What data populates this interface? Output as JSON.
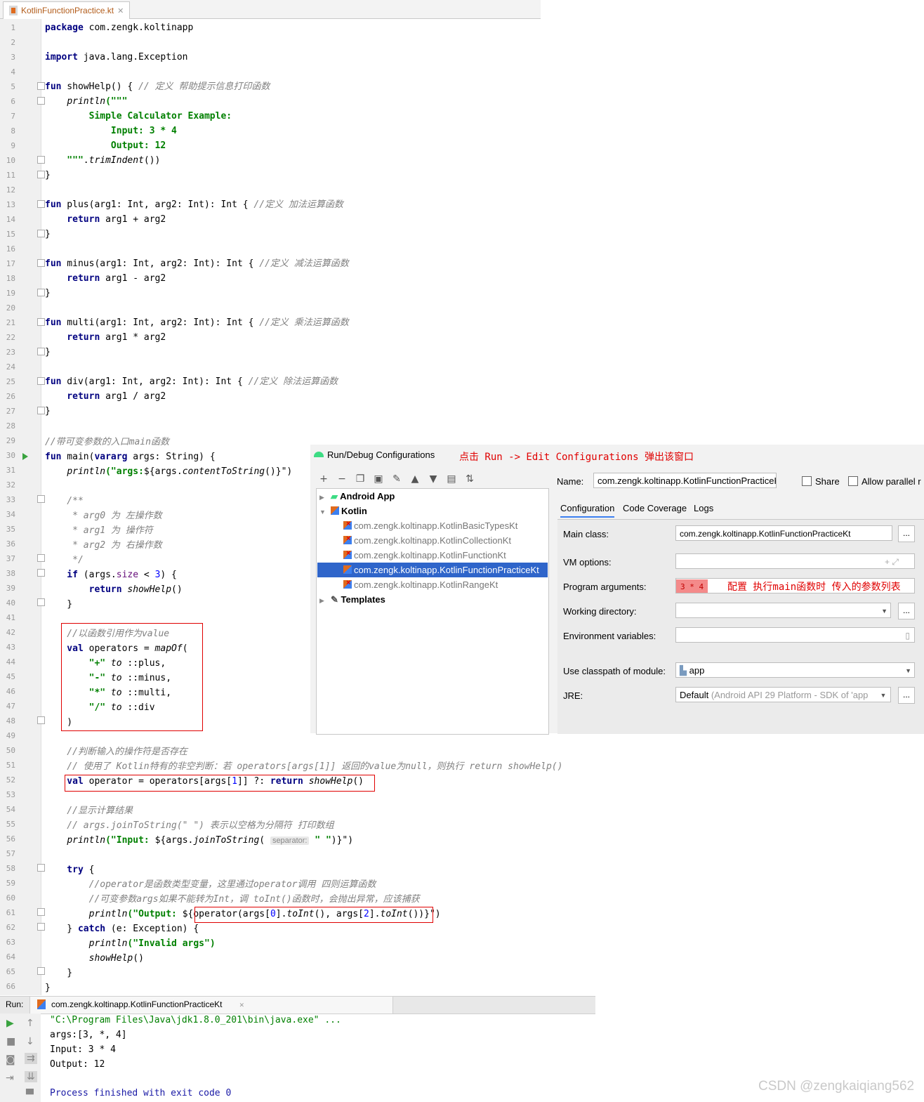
{
  "tab": {
    "title": "KotlinFunctionPractice.kt"
  },
  "editor": {
    "line_numbers": [
      "1",
      "2",
      "3",
      "4",
      "5",
      "6",
      "7",
      "8",
      "9",
      "10",
      "11",
      "12",
      "13",
      "14",
      "15",
      "16",
      "17",
      "18",
      "19",
      "20",
      "21",
      "22",
      "23",
      "24",
      "25",
      "26",
      "27",
      "28",
      "29",
      "30",
      "31",
      "32",
      "33",
      "34",
      "35",
      "36",
      "37",
      "38",
      "39",
      "40",
      "41",
      "42",
      "43",
      "44",
      "45",
      "46",
      "47",
      "48",
      "49",
      "50",
      "51",
      "52",
      "53",
      "54",
      "55",
      "56",
      "57",
      "58",
      "59",
      "60",
      "61",
      "62",
      "63",
      "64",
      "65",
      "66"
    ],
    "l1a": "package",
    "l1b": " com.zengk.koltinapp",
    "l3a": "import",
    "l3b": " java.lang.Exception",
    "l5a": "fun",
    "l5b": " showHelp() { ",
    "l5c": "// 定义 帮助提示信息打印函数",
    "l6a": "    ",
    "l6b": "println",
    "l6c": "(\"\"\"",
    "l7": "        Simple Calculator Example:",
    "l8": "            Input: 3 * 4",
    "l9": "            Output: 12",
    "l10a": "    \"\"\"",
    "l10b": ".",
    "l10c": "trimIndent",
    "l10d": "())",
    "l11": "}",
    "l13a": "fun",
    "l13b": " plus(arg1: Int, arg2: Int): Int { ",
    "l13c": "//定义 加法运算函数",
    "l14a": "    return",
    "l14b": " arg1 + arg2",
    "l15": "}",
    "l17a": "fun",
    "l17b": " minus(arg1: Int, arg2: Int): Int { ",
    "l17c": "//定义 减法运算函数",
    "l18a": "    return",
    "l18b": " arg1 - arg2",
    "l19": "}",
    "l21a": "fun",
    "l21b": " multi(arg1: Int, arg2: Int): Int { ",
    "l21c": "//定义 乘法运算函数",
    "l22a": "    return",
    "l22b": " arg1 * arg2",
    "l23": "}",
    "l25a": "fun",
    "l25b": " div(arg1: Int, arg2: Int): Int { ",
    "l25c": "//定义 除法运算函数",
    "l26a": "    return",
    "l26b": " arg1 / arg2",
    "l27": "}",
    "l29": "//带可变参数的入口main函数",
    "l30a": "fun",
    "l30b": " main(",
    "l30c": "vararg",
    "l30d": " args: String) {",
    "l31a": "    ",
    "l31b": "println",
    "l31c": "(\"args:",
    "l31d": "${",
    "l31e": "args.",
    "l31f": "contentToString",
    "l31g": "()}\")",
    "l33": "    /**",
    "l34": "     * arg0 为 左操作数",
    "l35": "     * arg1 为 操作符",
    "l36": "     * arg2 为 右操作数",
    "l37": "     */",
    "l38a": "    if",
    "l38b": " (args.",
    "l38c": "size",
    "l38d": " < ",
    "l38e": "3",
    "l38f": ") {",
    "l39a": "        return",
    "l39b": " showHelp",
    "l39c": "()",
    "l40": "    }",
    "l42": "    //以函数引用作为value",
    "l43a": "    val",
    "l43b": " operators = ",
    "l43c": "mapOf",
    "l43d": "(",
    "l44a": "        \"+\"",
    "l44b": " to",
    "l44c": " ::plus,",
    "l45a": "        \"-\"",
    "l45b": " to",
    "l45c": " ::minus,",
    "l46a": "        \"*\"",
    "l46b": " to",
    "l46c": " ::multi,",
    "l47a": "        \"/\"",
    "l47b": " to",
    "l47c": " ::div",
    "l48": "    )",
    "l50": "    //判断输入的操作符是否存在",
    "l51": "    // 使用了 Kotlin特有的非空判断：若 operators[args[1]] 返回的value为null，则执行 return showHelp()",
    "l52a": "    val",
    "l52b": " operator = operators[args[",
    "l52c": "1",
    "l52d": "]] ?: ",
    "l52e": "return",
    "l52f": " showHelp",
    "l52g": "()",
    "l54": "    //显示计算结果",
    "l55": "    // args.joinToString(\" \") 表示以空格为分隔符 打印数组",
    "l56a": "    ",
    "l56b": "println",
    "l56c": "(\"Input: ",
    "l56d": "${args.",
    "l56e": "joinToString",
    "l56f": "( ",
    "l56g": "separator:",
    "l56h": " \" \"",
    "l56i": ")}\")",
    "l58a": "    try",
    "l58b": " {",
    "l59": "        //operator是函数类型变量，这里通过operator调用 四则运算函数",
    "l60": "        //可变参数args如果不能转为Int，调 toInt()函数时，会抛出异常，应该捕获",
    "l61a": "        ",
    "l61b": "println",
    "l61c": "(\"Output: ",
    "l61d": "${",
    "l61e": "operator(args[",
    "l61f": "0",
    "l61g": "].",
    "l61h": "toInt",
    "l61i": "(), args[",
    "l61j": "2",
    "l61k": "].",
    "l61l": "toInt",
    "l61m": "())",
    "l61n": "}\")",
    "l62a": "    } ",
    "l62b": "catch",
    "l62c": " (e: Exception) {",
    "l63a": "        ",
    "l63b": "println",
    "l63c": "(\"Invalid args\")",
    "l64a": "        ",
    "l64b": "showHelp",
    "l64c": "()",
    "l65": "    }",
    "l66": "}"
  },
  "dialog": {
    "title": "Run/Debug Configurations",
    "annotation_top": "点击 Run -> Edit Configurations 弹出该窗口",
    "toolbar_icons": [
      "plus-icon",
      "minus-icon",
      "copy-icon",
      "save-icon",
      "wrench-icon",
      "arrow-up-icon",
      "arrow-down-icon",
      "folder-icon",
      "sort-icon"
    ],
    "tree": {
      "android_app": "Android App",
      "kotlin": "Kotlin",
      "items": [
        "com.zengk.koltinapp.KotlinBasicTypesKt",
        "com.zengk.koltinapp.KotlinCollectionKt",
        "com.zengk.koltinapp.KotlinFunctionKt",
        "com.zengk.koltinapp.KotlinFunctionPracticeKt",
        "com.zengk.koltinapp.KotlinRangeKt"
      ],
      "templates": "Templates"
    },
    "name_label": "Name:",
    "name_value": "com.zengk.koltinapp.KotlinFunctionPracticeKt",
    "share_label": "Share",
    "allow_parallel_label": "Allow parallel r",
    "tabs": [
      "Configuration",
      "Code Coverage",
      "Logs"
    ],
    "main_class_label": "Main class:",
    "main_class_value": "com.zengk.koltinapp.KotlinFunctionPracticeKt",
    "vm_options_label": "VM options:",
    "program_args_label": "Program arguments:",
    "program_args_value": "3 * 4",
    "program_args_annotation": "配置 执行main函数时 传入的参数列表",
    "working_dir_label": "Working directory:",
    "env_vars_label": "Environment variables:",
    "classpath_label": "Use classpath of module:",
    "classpath_value": "app",
    "jre_label": "JRE:",
    "jre_value_a": "Default",
    "jre_value_b": " (Android API 29 Platform - SDK of 'app",
    "ellipsis": "..."
  },
  "run": {
    "label": "Run:",
    "tab_title": "com.zengk.koltinapp.KotlinFunctionPracticeKt",
    "output": [
      "\"C:\\Program Files\\Java\\jdk1.8.0_201\\bin\\java.exe\" ...",
      "args:[3, *, 4]",
      "Input: 3 * 4",
      "Output: 12",
      "",
      "Process finished with exit code 0"
    ]
  },
  "watermark": "CSDN @zengkaiqiang562",
  "colors": {
    "keyword": "#000080",
    "string": "#008000",
    "comment": "#808080",
    "number": "#0000ff",
    "annotation_red": "#e00000",
    "selection": "#2f65ca"
  }
}
